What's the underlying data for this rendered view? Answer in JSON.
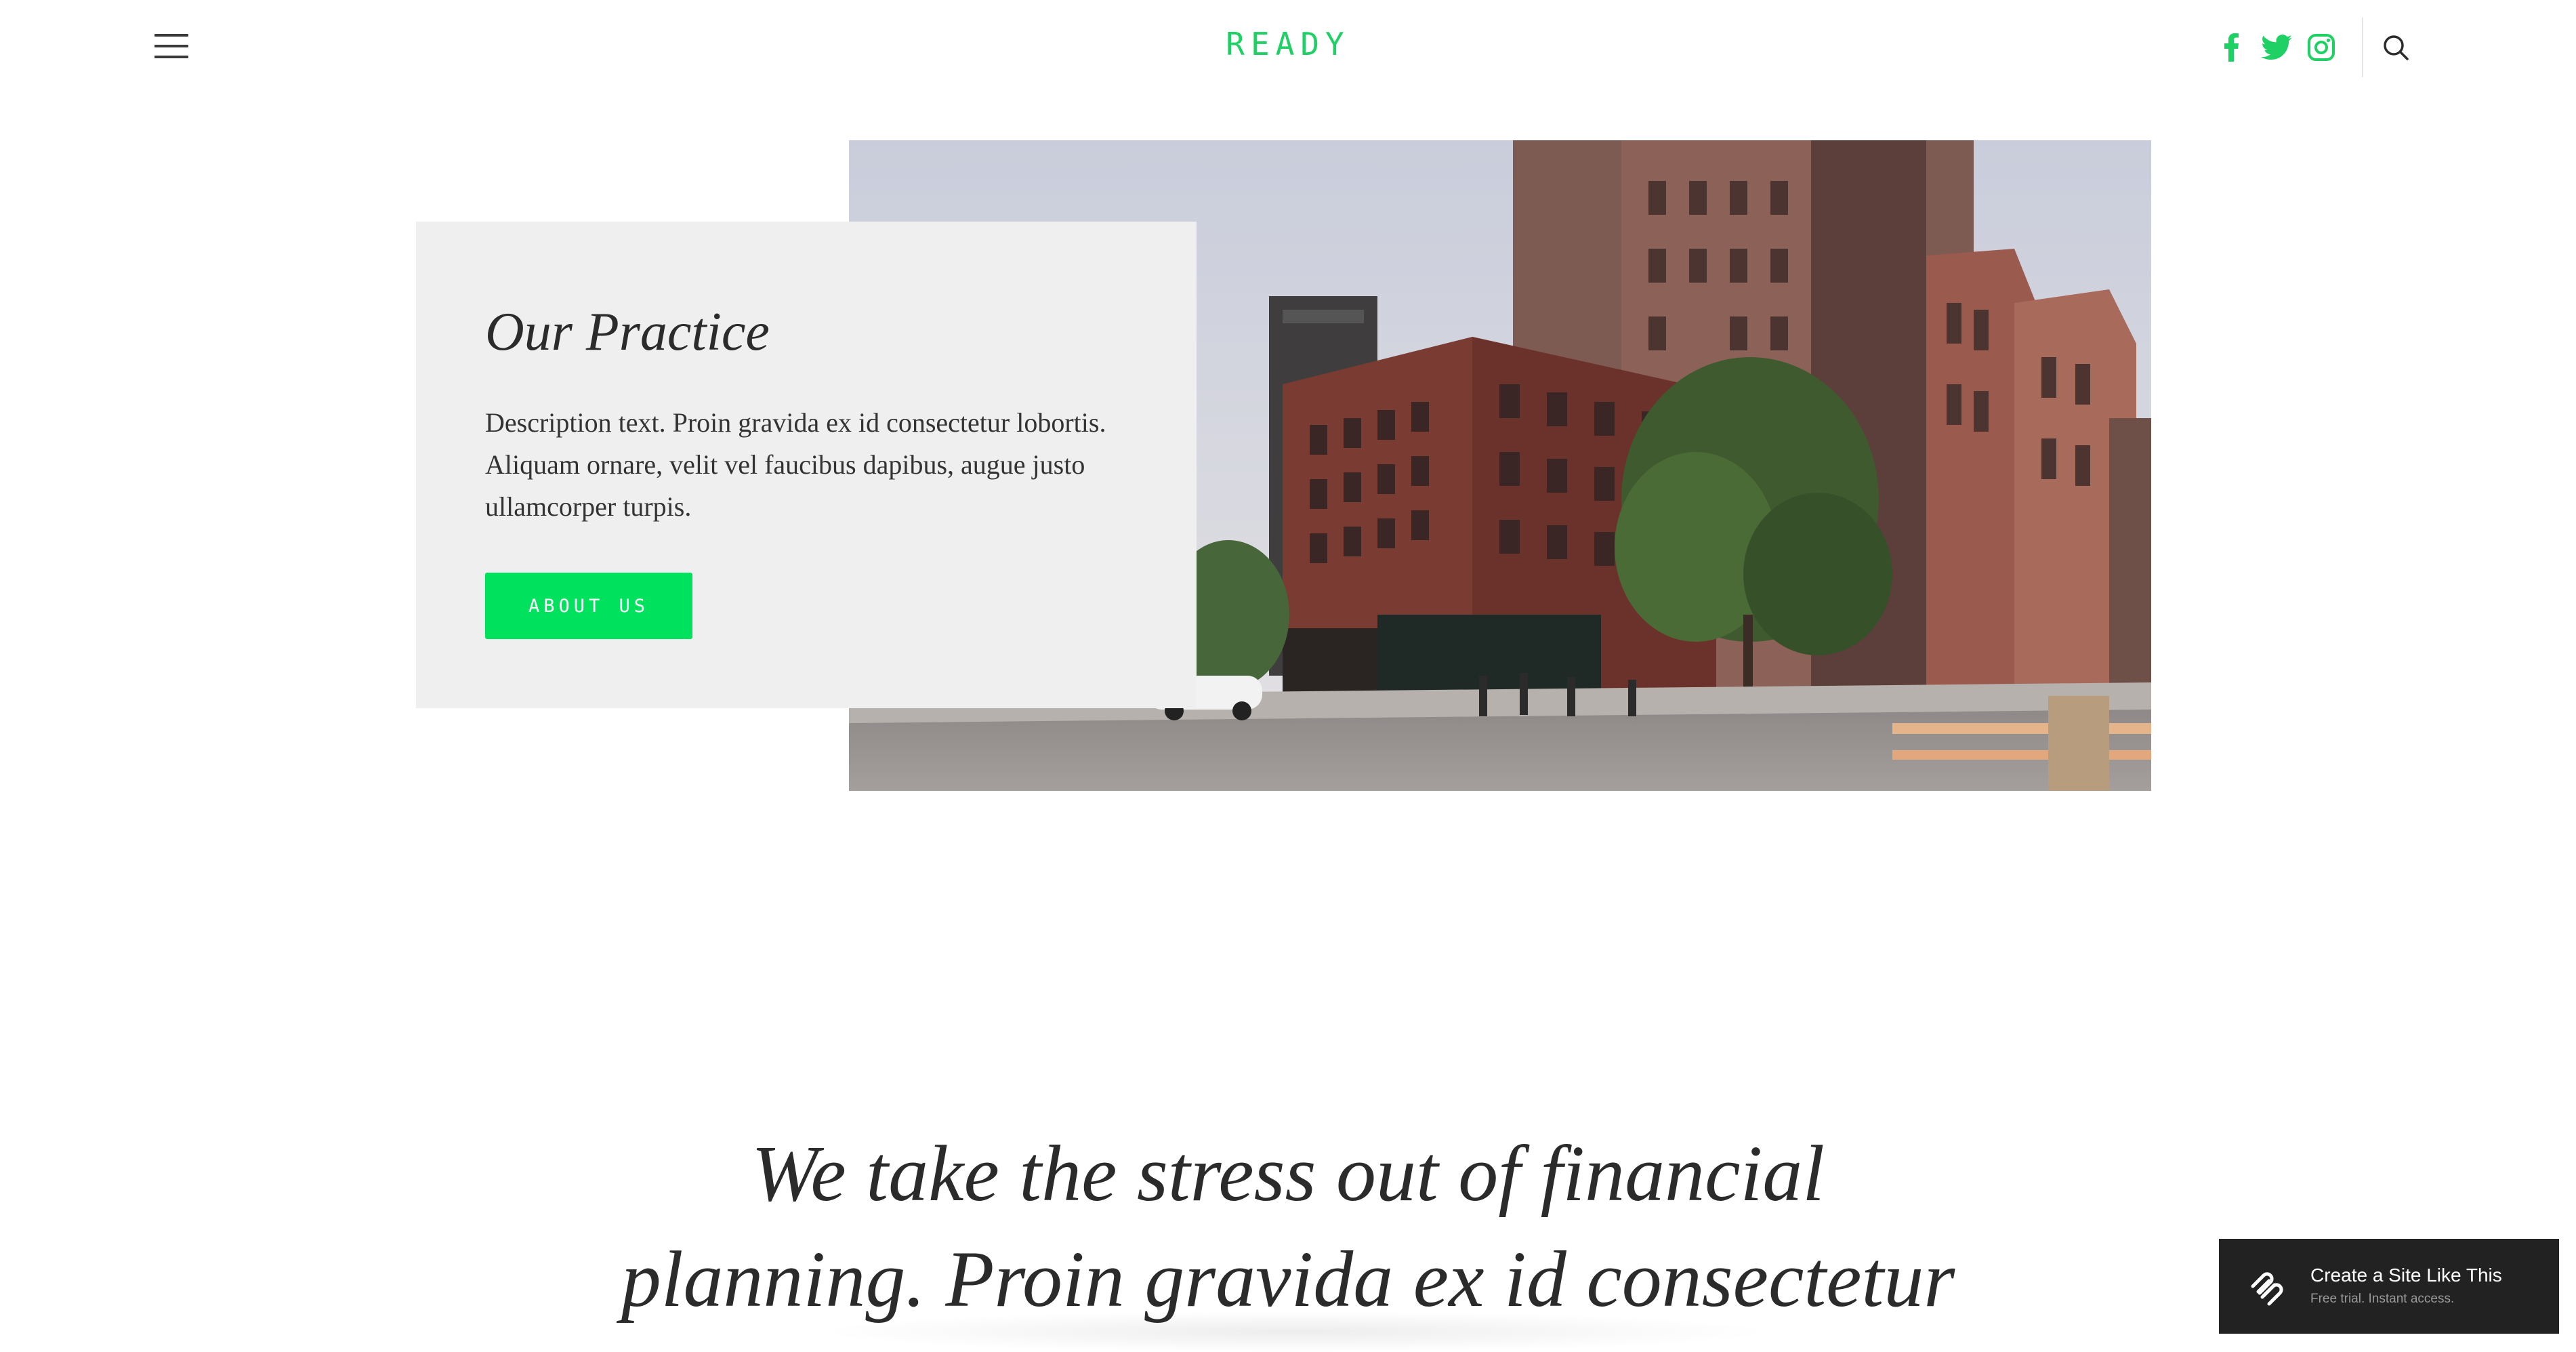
{
  "header": {
    "logo": "READY",
    "menu_icon": "hamburger-menu-icon",
    "social": [
      {
        "name": "facebook",
        "icon": "facebook-icon"
      },
      {
        "name": "twitter",
        "icon": "twitter-icon"
      },
      {
        "name": "instagram",
        "icon": "instagram-icon"
      }
    ],
    "search_icon": "search-icon"
  },
  "hero": {
    "title": "Our Practice",
    "description": "Description text. Proin gravida ex id consectetur lobortis. Aliquam ornare, velit vel faucibus dapibus, augue justo ullamcorper turpis.",
    "button_label": "ABOUT US",
    "image": "city-street-brick-buildings-photo"
  },
  "quote": {
    "line1": "We take the stress out of financial",
    "line2": "planning. Proin gravida ex id consectetur"
  },
  "badge": {
    "title": "Create a Site Like This",
    "subtitle": "Free trial. Instant access.",
    "icon": "squarespace-logo-icon"
  },
  "colors": {
    "accent": "#00e25e",
    "logo": "#1fd165",
    "card_bg": "#efefef",
    "badge_bg": "#222222",
    "text": "#2b2b2b"
  }
}
